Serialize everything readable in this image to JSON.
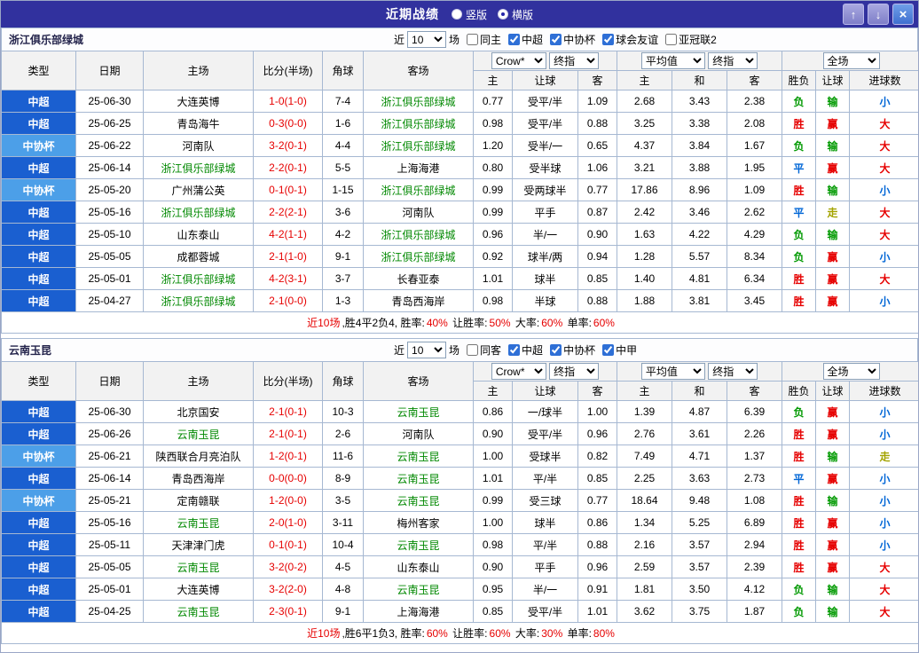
{
  "titlebar": {
    "title": "近期战绩",
    "radios": [
      {
        "label": "竖版",
        "selected": false
      },
      {
        "label": "横版",
        "selected": true
      }
    ],
    "buttons": {
      "up": "↑",
      "down": "↓",
      "close": "×"
    }
  },
  "table_header": {
    "type": "类型",
    "date": "日期",
    "home": "主场",
    "score": "比分(半场)",
    "corner": "角球",
    "away": "客场",
    "asian_sub": [
      "主",
      "让球",
      "客"
    ],
    "euro_sub": [
      "主",
      "和",
      "客"
    ],
    "result_sub": [
      "胜负",
      "让球",
      "进球数"
    ]
  },
  "colors": {
    "accent": "#31319E",
    "league_type": "#1A5FD0",
    "cup_type": "#4C9FE8",
    "focus_team": "#008800",
    "win": "#E60000",
    "lose": "#009900",
    "draw": "#0066D6",
    "push": "#A3A300"
  },
  "sections": [
    {
      "team": "浙江俱乐部绿城",
      "filter": {
        "prefix": "近",
        "count": "10",
        "suffix": "场",
        "checkboxes": [
          {
            "label": "同主",
            "checked": false
          },
          {
            "label": "中超",
            "checked": true
          },
          {
            "label": "中协杯",
            "checked": true
          },
          {
            "label": "球会友谊",
            "checked": true
          },
          {
            "label": "亚冠联2",
            "checked": false
          }
        ]
      },
      "selectors": {
        "asian_company": "Crow*",
        "asian_time": "终指",
        "euro_company": "平均值",
        "euro_time": "终指",
        "scope": "全场"
      },
      "rows": [
        {
          "type": "中超",
          "date": "25-06-30",
          "home": "大连英博",
          "score": "1-0(1-0)",
          "corner": "7-4",
          "away": "浙江俱乐部绿城",
          "focus": "away",
          "asian": [
            "0.77",
            "受平/半",
            "1.09"
          ],
          "euro": [
            "2.68",
            "3.43",
            "2.38"
          ],
          "results": [
            [
              "负",
              "green"
            ],
            [
              "输",
              "green"
            ],
            [
              "小",
              "blue"
            ]
          ]
        },
        {
          "type": "中超",
          "date": "25-06-25",
          "home": "青岛海牛",
          "score": "0-3(0-0)",
          "corner": "1-6",
          "away": "浙江俱乐部绿城",
          "focus": "away",
          "asian": [
            "0.98",
            "受平/半",
            "0.88"
          ],
          "euro": [
            "3.25",
            "3.38",
            "2.08"
          ],
          "results": [
            [
              "胜",
              "red"
            ],
            [
              "赢",
              "red"
            ],
            [
              "大",
              "red"
            ]
          ]
        },
        {
          "type": "中协杯",
          "date": "25-06-22",
          "home": "河南队",
          "score": "3-2(0-1)",
          "corner": "4-4",
          "away": "浙江俱乐部绿城",
          "focus": "away",
          "asian": [
            "1.20",
            "受半/一",
            "0.65"
          ],
          "euro": [
            "4.37",
            "3.84",
            "1.67"
          ],
          "results": [
            [
              "负",
              "green"
            ],
            [
              "输",
              "green"
            ],
            [
              "大",
              "red"
            ]
          ]
        },
        {
          "type": "中超",
          "date": "25-06-14",
          "home": "浙江俱乐部绿城",
          "score": "2-2(0-1)",
          "corner": "5-5",
          "away": "上海海港",
          "focus": "home",
          "asian": [
            "0.80",
            "受半球",
            "1.06"
          ],
          "euro": [
            "3.21",
            "3.88",
            "1.95"
          ],
          "results": [
            [
              "平",
              "blue"
            ],
            [
              "赢",
              "red"
            ],
            [
              "大",
              "red"
            ]
          ]
        },
        {
          "type": "中协杯",
          "date": "25-05-20",
          "home": "广州蒲公英",
          "score": "0-1(0-1)",
          "corner": "1-15",
          "away": "浙江俱乐部绿城",
          "focus": "away",
          "asian": [
            "0.99",
            "受两球半",
            "0.77"
          ],
          "euro": [
            "17.86",
            "8.96",
            "1.09"
          ],
          "results": [
            [
              "胜",
              "red"
            ],
            [
              "输",
              "green"
            ],
            [
              "小",
              "blue"
            ]
          ]
        },
        {
          "type": "中超",
          "date": "25-05-16",
          "home": "浙江俱乐部绿城",
          "score": "2-2(2-1)",
          "corner": "3-6",
          "away": "河南队",
          "focus": "home",
          "asian": [
            "0.99",
            "平手",
            "0.87"
          ],
          "euro": [
            "2.42",
            "3.46",
            "2.62"
          ],
          "results": [
            [
              "平",
              "blue"
            ],
            [
              "走",
              "olive"
            ],
            [
              "大",
              "red"
            ]
          ]
        },
        {
          "type": "中超",
          "date": "25-05-10",
          "home": "山东泰山",
          "score": "4-2(1-1)",
          "corner": "4-2",
          "away": "浙江俱乐部绿城",
          "focus": "away",
          "asian": [
            "0.96",
            "半/一",
            "0.90"
          ],
          "euro": [
            "1.63",
            "4.22",
            "4.29"
          ],
          "results": [
            [
              "负",
              "green"
            ],
            [
              "输",
              "green"
            ],
            [
              "大",
              "red"
            ]
          ]
        },
        {
          "type": "中超",
          "date": "25-05-05",
          "home": "成都蓉城",
          "score": "2-1(1-0)",
          "corner": "9-1",
          "away": "浙江俱乐部绿城",
          "focus": "away",
          "asian": [
            "0.92",
            "球半/两",
            "0.94"
          ],
          "euro": [
            "1.28",
            "5.57",
            "8.34"
          ],
          "results": [
            [
              "负",
              "green"
            ],
            [
              "赢",
              "red"
            ],
            [
              "小",
              "blue"
            ]
          ]
        },
        {
          "type": "中超",
          "date": "25-05-01",
          "home": "浙江俱乐部绿城",
          "score": "4-2(3-1)",
          "corner": "3-7",
          "away": "长春亚泰",
          "focus": "home",
          "asian": [
            "1.01",
            "球半",
            "0.85"
          ],
          "euro": [
            "1.40",
            "4.81",
            "6.34"
          ],
          "results": [
            [
              "胜",
              "red"
            ],
            [
              "赢",
              "red"
            ],
            [
              "大",
              "red"
            ]
          ]
        },
        {
          "type": "中超",
          "date": "25-04-27",
          "home": "浙江俱乐部绿城",
          "score": "2-1(0-0)",
          "corner": "1-3",
          "away": "青岛西海岸",
          "focus": "home",
          "asian": [
            "0.98",
            "半球",
            "0.88"
          ],
          "euro": [
            "1.88",
            "3.81",
            "3.45"
          ],
          "results": [
            [
              "胜",
              "red"
            ],
            [
              "赢",
              "red"
            ],
            [
              "小",
              "blue"
            ]
          ]
        }
      ],
      "summary": [
        {
          "text": "近10场",
          "color": "red"
        },
        {
          "text": ",胜4平2负4, 胜率:",
          "color": "black"
        },
        {
          "text": "40%",
          "color": "red"
        },
        {
          "text": " 让胜率:",
          "color": "black"
        },
        {
          "text": "50%",
          "color": "red"
        },
        {
          "text": " 大率:",
          "color": "black"
        },
        {
          "text": "60%",
          "color": "red"
        },
        {
          "text": " 单率:",
          "color": "black"
        },
        {
          "text": "60%",
          "color": "red"
        }
      ]
    },
    {
      "team": "云南玉昆",
      "filter": {
        "prefix": "近",
        "count": "10",
        "suffix": "场",
        "checkboxes": [
          {
            "label": "同客",
            "checked": false
          },
          {
            "label": "中超",
            "checked": true
          },
          {
            "label": "中协杯",
            "checked": true
          },
          {
            "label": "中甲",
            "checked": true
          }
        ]
      },
      "selectors": {
        "asian_company": "Crow*",
        "asian_time": "终指",
        "euro_company": "平均值",
        "euro_time": "终指",
        "scope": "全场"
      },
      "rows": [
        {
          "type": "中超",
          "date": "25-06-30",
          "home": "北京国安",
          "score": "2-1(0-1)",
          "corner": "10-3",
          "away": "云南玉昆",
          "focus": "away",
          "asian": [
            "0.86",
            "一/球半",
            "1.00"
          ],
          "euro": [
            "1.39",
            "4.87",
            "6.39"
          ],
          "results": [
            [
              "负",
              "green"
            ],
            [
              "赢",
              "red"
            ],
            [
              "小",
              "blue"
            ]
          ]
        },
        {
          "type": "中超",
          "date": "25-06-26",
          "home": "云南玉昆",
          "score": "2-1(0-1)",
          "corner": "2-6",
          "away": "河南队",
          "focus": "home",
          "asian": [
            "0.90",
            "受平/半",
            "0.96"
          ],
          "euro": [
            "2.76",
            "3.61",
            "2.26"
          ],
          "results": [
            [
              "胜",
              "red"
            ],
            [
              "赢",
              "red"
            ],
            [
              "小",
              "blue"
            ]
          ]
        },
        {
          "type": "中协杯",
          "date": "25-06-21",
          "home": "陕西联合月亮泊队",
          "score": "1-2(0-1)",
          "corner": "11-6",
          "away": "云南玉昆",
          "focus": "away",
          "asian": [
            "1.00",
            "受球半",
            "0.82"
          ],
          "euro": [
            "7.49",
            "4.71",
            "1.37"
          ],
          "results": [
            [
              "胜",
              "red"
            ],
            [
              "输",
              "green"
            ],
            [
              "走",
              "olive"
            ]
          ]
        },
        {
          "type": "中超",
          "date": "25-06-14",
          "home": "青岛西海岸",
          "score": "0-0(0-0)",
          "corner": "8-9",
          "away": "云南玉昆",
          "focus": "away",
          "asian": [
            "1.01",
            "平/半",
            "0.85"
          ],
          "euro": [
            "2.25",
            "3.63",
            "2.73"
          ],
          "results": [
            [
              "平",
              "blue"
            ],
            [
              "赢",
              "red"
            ],
            [
              "小",
              "blue"
            ]
          ]
        },
        {
          "type": "中协杯",
          "date": "25-05-21",
          "home": "定南赣联",
          "score": "1-2(0-0)",
          "corner": "3-5",
          "away": "云南玉昆",
          "focus": "away",
          "asian": [
            "0.99",
            "受三球",
            "0.77"
          ],
          "euro": [
            "18.64",
            "9.48",
            "1.08"
          ],
          "results": [
            [
              "胜",
              "red"
            ],
            [
              "输",
              "green"
            ],
            [
              "小",
              "blue"
            ]
          ]
        },
        {
          "type": "中超",
          "date": "25-05-16",
          "home": "云南玉昆",
          "score": "2-0(1-0)",
          "corner": "3-11",
          "away": "梅州客家",
          "focus": "home",
          "asian": [
            "1.00",
            "球半",
            "0.86"
          ],
          "euro": [
            "1.34",
            "5.25",
            "6.89"
          ],
          "results": [
            [
              "胜",
              "red"
            ],
            [
              "赢",
              "red"
            ],
            [
              "小",
              "blue"
            ]
          ]
        },
        {
          "type": "中超",
          "date": "25-05-11",
          "home": "天津津门虎",
          "score": "0-1(0-1)",
          "corner": "10-4",
          "away": "云南玉昆",
          "focus": "away",
          "asian": [
            "0.98",
            "平/半",
            "0.88"
          ],
          "euro": [
            "2.16",
            "3.57",
            "2.94"
          ],
          "results": [
            [
              "胜",
              "red"
            ],
            [
              "赢",
              "red"
            ],
            [
              "小",
              "blue"
            ]
          ]
        },
        {
          "type": "中超",
          "date": "25-05-05",
          "home": "云南玉昆",
          "score": "3-2(0-2)",
          "corner": "4-5",
          "away": "山东泰山",
          "focus": "home",
          "asian": [
            "0.90",
            "平手",
            "0.96"
          ],
          "euro": [
            "2.59",
            "3.57",
            "2.39"
          ],
          "results": [
            [
              "胜",
              "red"
            ],
            [
              "赢",
              "red"
            ],
            [
              "大",
              "red"
            ]
          ]
        },
        {
          "type": "中超",
          "date": "25-05-01",
          "home": "大连英博",
          "score": "3-2(2-0)",
          "corner": "4-8",
          "away": "云南玉昆",
          "focus": "away",
          "asian": [
            "0.95",
            "半/一",
            "0.91"
          ],
          "euro": [
            "1.81",
            "3.50",
            "4.12"
          ],
          "results": [
            [
              "负",
              "green"
            ],
            [
              "输",
              "green"
            ],
            [
              "大",
              "red"
            ]
          ]
        },
        {
          "type": "中超",
          "date": "25-04-25",
          "home": "云南玉昆",
          "score": "2-3(0-1)",
          "corner": "9-1",
          "away": "上海海港",
          "focus": "home",
          "asian": [
            "0.85",
            "受平/半",
            "1.01"
          ],
          "euro": [
            "3.62",
            "3.75",
            "1.87"
          ],
          "results": [
            [
              "负",
              "green"
            ],
            [
              "输",
              "green"
            ],
            [
              "大",
              "red"
            ]
          ]
        }
      ],
      "summary": [
        {
          "text": "近10场",
          "color": "red"
        },
        {
          "text": ",胜6平1负3, 胜率:",
          "color": "black"
        },
        {
          "text": "60%",
          "color": "red"
        },
        {
          "text": " 让胜率:",
          "color": "black"
        },
        {
          "text": "60%",
          "color": "red"
        },
        {
          "text": " 大率:",
          "color": "black"
        },
        {
          "text": "30%",
          "color": "red"
        },
        {
          "text": " 单率:",
          "color": "black"
        },
        {
          "text": "80%",
          "color": "red"
        }
      ]
    }
  ]
}
